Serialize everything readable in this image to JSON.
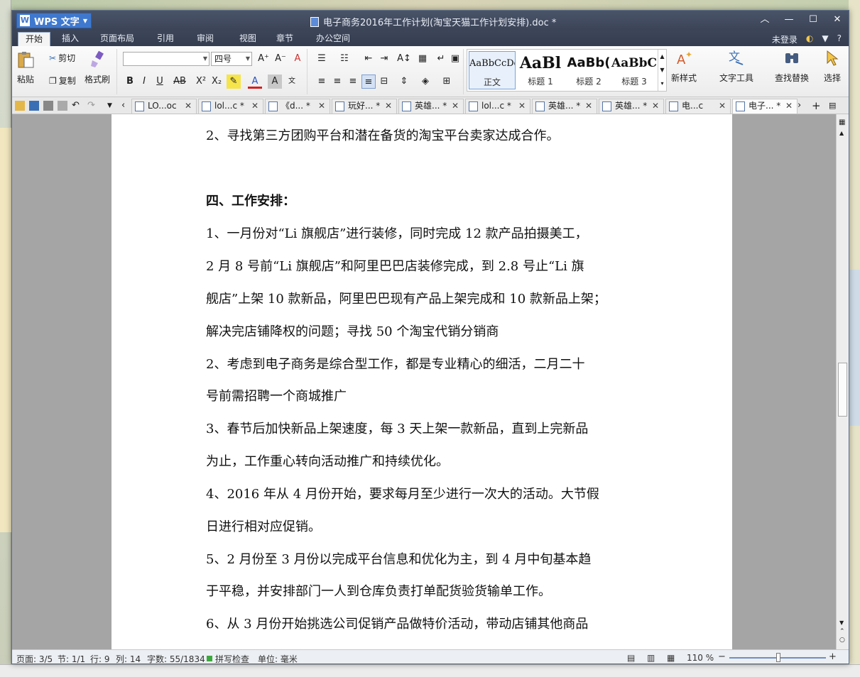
{
  "app": {
    "name": "WPS 文字",
    "doc_title": "电子商务2016年工作计划(淘宝天猫工作计划安排).doc *"
  },
  "menu": {
    "tabs": [
      "开始",
      "插入",
      "页面布局",
      "引用",
      "审阅",
      "视图",
      "章节",
      "办公空间"
    ],
    "login": "未登录",
    "help": "?"
  },
  "ribbon": {
    "paste": "粘贴",
    "cut": "剪切",
    "copy": "复制",
    "format_painter": "格式刷",
    "font_name": "",
    "font_size": "四号",
    "styles": [
      {
        "preview": "AaBbCcDd",
        "label": "正文"
      },
      {
        "preview": "AaBl",
        "label": "标题 1"
      },
      {
        "preview": "AaBb(",
        "label": "标题 2"
      },
      {
        "preview": "AaBbC",
        "label": "标题 3"
      }
    ],
    "new_style": "新样式",
    "text_tools": "文字工具",
    "find_replace": "查找替换",
    "select": "选择"
  },
  "doc_tabs": [
    {
      "label": "LO...oc"
    },
    {
      "label": "lol...c *"
    },
    {
      "label": "《d... *"
    },
    {
      "label": "玩好... *"
    },
    {
      "label": "英雄... *"
    },
    {
      "label": "lol...c *"
    },
    {
      "label": "英雄... *"
    },
    {
      "label": "英雄... *"
    },
    {
      "label": "电...c"
    },
    {
      "label": "电子... *"
    }
  ],
  "document": {
    "paragraphs": [
      "2、寻找第三方团购平台和潜在备货的淘宝平台卖家达成合作。",
      "四、工作安排：",
      "1、一月份对“Li 旗舰店”进行装修，同时完成 12 款产品拍摄美工，",
      "2 月 8 号前“Li 旗舰店”和阿里巴巴店装修完成，到 2.8 号止“Li 旗",
      "舰店”上架 10 款新品，阿里巴巴现有产品上架完成和 10 款新品上架；",
      "解决完店铺降权的问题；寻找 50 个淘宝代销分销商",
      "2、考虑到电子商务是综合型工作，都是专业精心的细活，二月二十",
      "号前需招聘一个商城推广",
      "3、春节后加快新品上架速度，每 3 天上架一款新品，直到上完新品",
      "为止，工作重心转向活动推广和持续优化。",
      "4、2016 年从 4 月份开始，要求每月至少进行一次大的活动。大节假",
      "日进行相对应促销。",
      "5、2 月份至 3 月份以完成平台信息和优化为主，到 4 月中旬基本趋",
      "于平稳，并安排部门一人到仓库负责打单配货验货输单工作。",
      "6、从 3 月份开始挑选公司促销产品做特价活动，带动店铺其他商品"
    ]
  },
  "status": {
    "page": "页面: 3/5",
    "section": "节: 1/1",
    "row": "行: 9",
    "col": "列: 14",
    "words": "字数: 55/1834",
    "spell": "拼写检查",
    "unit": "单位: 毫米",
    "zoom": "110 %"
  },
  "zoom_level": 110
}
